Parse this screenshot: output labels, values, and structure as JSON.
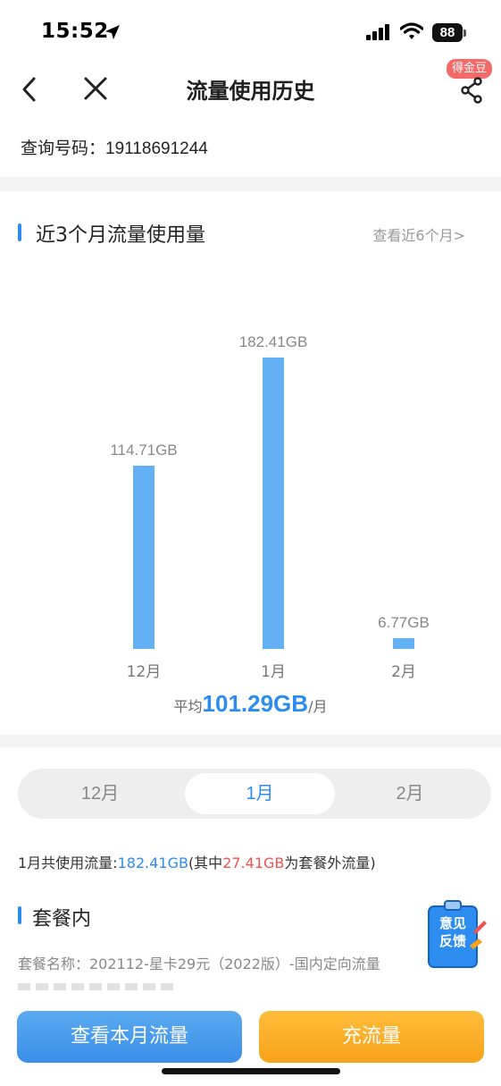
{
  "status_bar": {
    "time": "15:52",
    "battery": "88"
  },
  "nav": {
    "title": "流量使用历史",
    "reward_badge": "得金豆"
  },
  "query": {
    "label": "查询号码：",
    "number": "19118691244"
  },
  "usage_section": {
    "title": "近3个月流量使用量",
    "more_link": "查看近6个月>"
  },
  "chart_data": {
    "type": "bar",
    "categories": [
      "12月",
      "1月",
      "2月"
    ],
    "values": [
      114.71,
      182.41,
      6.77
    ],
    "value_labels": [
      "114.71GB",
      "182.41GB",
      "6.77GB"
    ],
    "unit": "GB",
    "color": "#64b0f4"
  },
  "average": {
    "prefix": "平均",
    "value": "101.29GB",
    "suffix": "/月"
  },
  "tabs": [
    {
      "label": "12月",
      "active": false
    },
    {
      "label": "1月",
      "active": true
    },
    {
      "label": "2月",
      "active": false
    }
  ],
  "summary": {
    "text1": "1月共使用流量:",
    "total": "182.41GB",
    "text2": "(其中",
    "extra": "27.41GB",
    "text3": "为套餐外流量)"
  },
  "plan_section": {
    "title": "套餐内",
    "plan_name": "套餐名称：202112-星卡29元（2022版）-国内定向流量"
  },
  "feedback": {
    "line1": "意见",
    "line2": "反馈"
  },
  "buttons": {
    "view_month": "查看本月流量",
    "recharge": "充流量"
  },
  "colors": {
    "accent": "#2d8cf0",
    "bar": "#64b0f4",
    "warning": "#ef5350",
    "orange": "#f7a21b"
  }
}
